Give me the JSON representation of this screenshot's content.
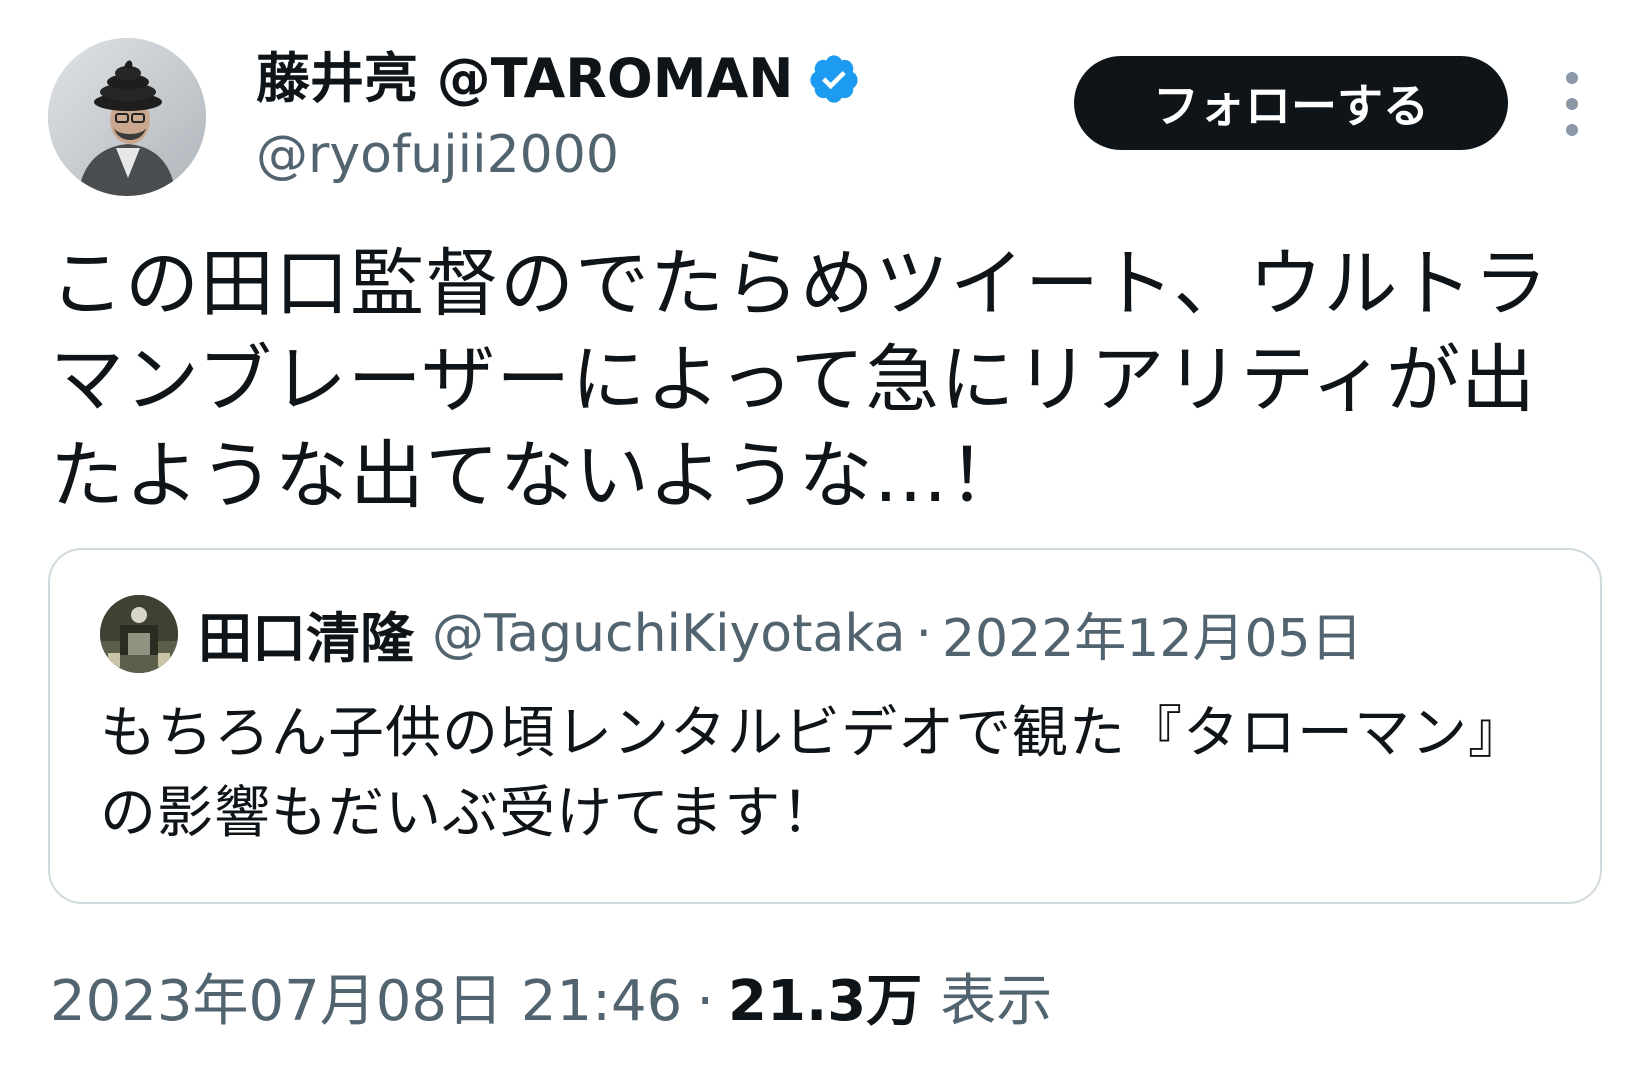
{
  "author": {
    "display_name": "藤井亮 @TAROMAN",
    "handle": "@ryofujii2000",
    "verified": true
  },
  "actions": {
    "follow_label": "フォローする"
  },
  "tweet": {
    "text": "この田口監督のでたらめツイート、ウルトラマンブレーザーによって急にリアリティが出たような出てないような…！",
    "timestamp": "2023年07月08日 21:46",
    "separator": "·",
    "views_count": "21.3万",
    "views_label": "表示"
  },
  "quoted_tweet": {
    "display_name": "田口清隆",
    "handle": "@TaguchiKiyotaka",
    "separator": "·",
    "date": "2022年12月05日",
    "text": "もちろん子供の頃レンタルビデオで観た『タローマン』の影響もだいぶ受けてます！"
  },
  "colors": {
    "verified_badge": "#1d9bf0",
    "follow_button_bg": "#0f1419",
    "secondary_text": "#536471",
    "card_border": "#cfd9de"
  },
  "icons": {
    "verified": "verified-badge-icon",
    "more": "more-vertical-icon"
  }
}
